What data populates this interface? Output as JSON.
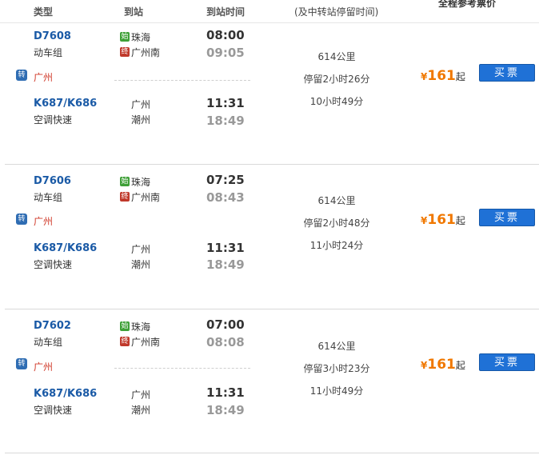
{
  "header": {
    "col_type": "类型",
    "col_station": "到站",
    "col_time": "到站时间",
    "col_info": "(及中转站停留时间)",
    "col_price": "全程参考票价"
  },
  "results": [
    {
      "leg1": {
        "train": "D7608",
        "type": "动车组",
        "badge_start": "始",
        "from": "珠海",
        "badge_end": "终",
        "to": "广州南",
        "dep": "08:00",
        "arr": "09:05"
      },
      "transfer_icon": "转",
      "transfer_city": "广州",
      "leg2": {
        "train": "K687/K686",
        "type": "空调快速",
        "from": "广州",
        "to": "潮州",
        "dep": "11:31",
        "arr": "18:49"
      },
      "distance": "614公里",
      "stay": "停留2小时26分",
      "total": "10小时49分",
      "price_symbol": "¥",
      "price": "161",
      "price_suffix": "起",
      "buy_label": "买票"
    },
    {
      "leg1": {
        "train": "D7606",
        "type": "动车组",
        "badge_start": "始",
        "from": "珠海",
        "badge_end": "终",
        "to": "广州南",
        "dep": "07:25",
        "arr": "08:43"
      },
      "transfer_icon": "转",
      "transfer_city": "广州",
      "leg2": {
        "train": "K687/K686",
        "type": "空调快速",
        "from": "广州",
        "to": "潮州",
        "dep": "11:31",
        "arr": "18:49"
      },
      "distance": "614公里",
      "stay": "停留2小时48分",
      "total": "11小时24分",
      "price_symbol": "¥",
      "price": "161",
      "price_suffix": "起",
      "buy_label": "买票"
    },
    {
      "leg1": {
        "train": "D7602",
        "type": "动车组",
        "badge_start": "始",
        "from": "珠海",
        "badge_end": "终",
        "to": "广州南",
        "dep": "07:00",
        "arr": "08:08"
      },
      "transfer_icon": "转",
      "transfer_city": "广州",
      "leg2": {
        "train": "K687/K686",
        "type": "空调快速",
        "from": "广州",
        "to": "潮州",
        "dep": "11:31",
        "arr": "18:49"
      },
      "distance": "614公里",
      "stay": "停留3小时23分",
      "total": "11小时49分",
      "price_symbol": "¥",
      "price": "161",
      "price_suffix": "起",
      "buy_label": "买票"
    }
  ]
}
